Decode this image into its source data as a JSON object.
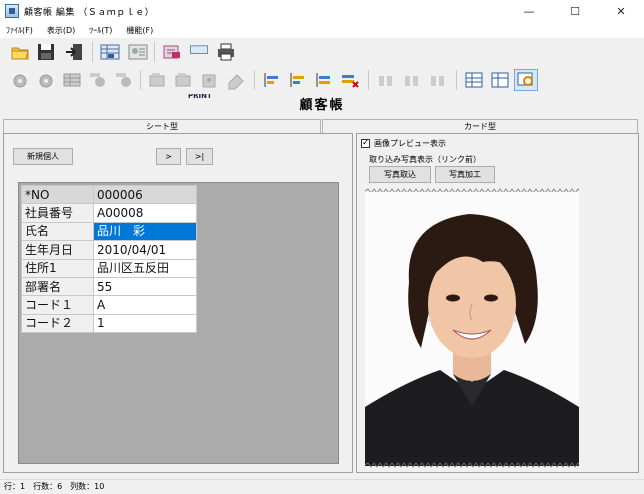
{
  "window": {
    "title": "顧客帳 編集 （Ｓａｍｐｌｅ）",
    "minimize": "—",
    "maximize": "☐",
    "close": "✕"
  },
  "menu": [
    {
      "label": "ﾌｧｲﾙ(F)"
    },
    {
      "label": "表示(D)"
    },
    {
      "label": "ﾂｰﾙ(T)"
    },
    {
      "label": "機能(F)"
    }
  ],
  "toolbar": {
    "print_label": "PRINT",
    "icons_row1": [
      "open-folder-icon",
      "save-icon",
      "exit-icon",
      "view-sheet-icon",
      "view-card-icon",
      "sort-icon",
      "print-icon",
      "printer-icon"
    ],
    "icons_row2": [
      "settings-icon",
      "settings2-icon",
      "table-icon",
      "sort-desc-icon",
      "sort-asc-icon",
      "text-edit-icon",
      "text-format-icon",
      "text-insert-icon",
      "eraser-icon",
      "align-left-icon",
      "align-center-icon",
      "align-right-icon",
      "delete-row-icon",
      "col-left-icon",
      "col-center-icon",
      "col-right-icon",
      "grid-select-icon",
      "grid-edit-icon",
      "search-record-icon"
    ]
  },
  "heading": "顧客帳",
  "tabs": {
    "sheet": "シート型",
    "card": "カード型"
  },
  "sheet": {
    "new_button": "新規個人",
    "next_button": ">",
    "last_button": ">|",
    "rows": [
      {
        "field": "*NO",
        "value": "000006"
      },
      {
        "field": "社員番号",
        "value": "A00008"
      },
      {
        "field": "氏名",
        "value": "品川　彩"
      },
      {
        "field": "生年月日",
        "value": "2010/04/01"
      },
      {
        "field": "住所1",
        "value": "品川区五反田"
      },
      {
        "field": "部署名",
        "value": "55"
      },
      {
        "field": "コード１",
        "value": "A"
      },
      {
        "field": "コード２",
        "value": "1"
      }
    ]
  },
  "card": {
    "preview_label": "画像プレビュー表示",
    "preview_checked": true,
    "link_label": "取り込み写真表示（リンク前）",
    "import_button": "写真取込",
    "edit_button": "写真加工"
  },
  "status": "行：1　行数：6　列数：10"
}
